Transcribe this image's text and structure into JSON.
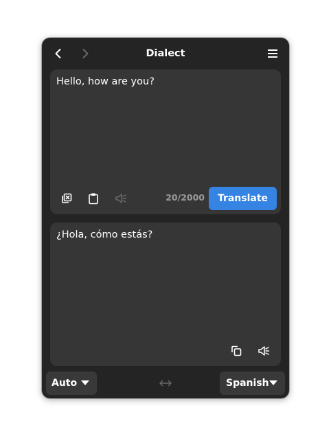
{
  "app": {
    "title": "Dialect"
  },
  "source": {
    "text": "Hello, how are you?",
    "char_count": "20/2000",
    "translate_label": "Translate"
  },
  "target": {
    "text": "¿Hola, cómo estás?"
  },
  "languages": {
    "source_label": "Auto",
    "target_label": "Spanish"
  },
  "icons": {
    "back": "go-previous-icon",
    "forward": "go-next-icon",
    "menu": "hamburger-menu-icon",
    "clear": "edit-clear-icon",
    "paste": "clipboard-paste-icon",
    "speak": "speaker-icon",
    "copy": "copy-icon",
    "switch": "switch-languages-icon"
  },
  "colors": {
    "window_bg": "#242424",
    "pane_bg": "#363636",
    "accent": "#3584e4",
    "dim": "#9a9a9a"
  }
}
